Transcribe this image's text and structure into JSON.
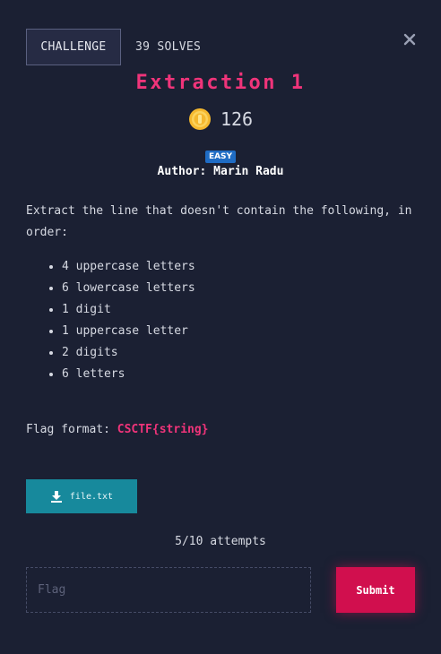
{
  "tabs": {
    "challenge": "CHALLENGE",
    "solves": "39 SOLVES"
  },
  "close_icon": "close-icon",
  "challenge": {
    "title": "Extraction 1",
    "points": "126",
    "difficulty": "EASY",
    "author": "Author: Marin Radu",
    "description": "Extract the line that doesn't contain the following, in order:",
    "requirements": [
      "4 uppercase letters",
      "6 lowercase letters",
      "1 digit",
      "1 uppercase letter",
      "2 digits",
      "6 letters"
    ],
    "flag_format_label": "Flag format:",
    "flag_format_value": "CSCTF{string}"
  },
  "file": {
    "name": "file.txt",
    "icon": "download-icon"
  },
  "attempts": "5/10 attempts",
  "form": {
    "placeholder": "Flag",
    "submit_label": "Submit"
  },
  "colors": {
    "background": "#1b2033",
    "accent": "#f0347a",
    "submit": "#d10f4e",
    "download": "#17899c",
    "badge": "#1f6cc4"
  }
}
